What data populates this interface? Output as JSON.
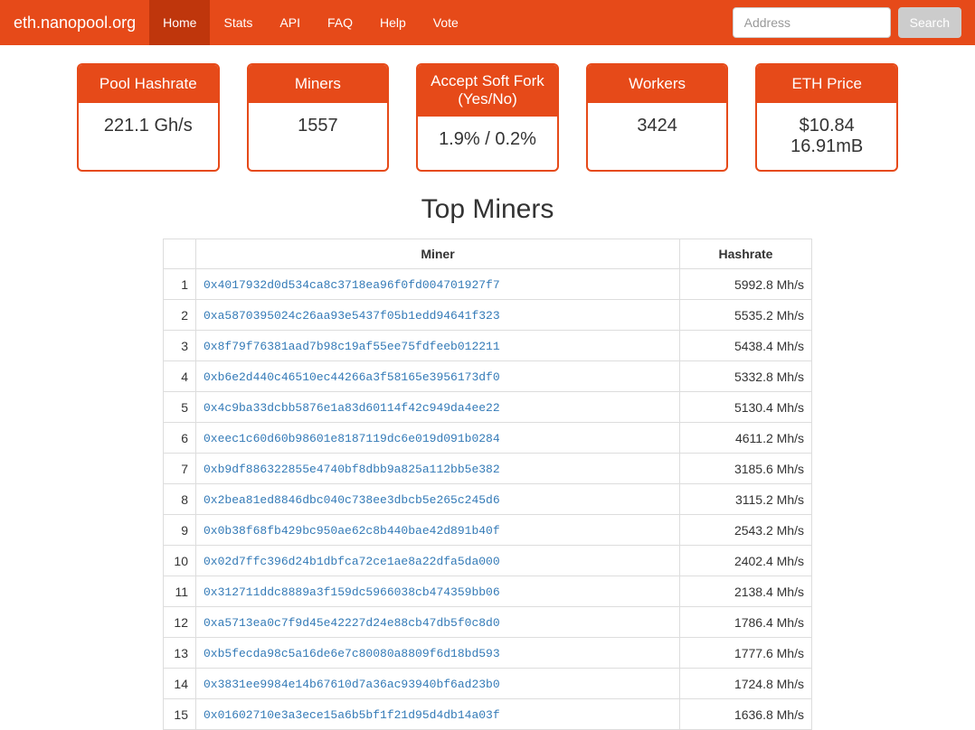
{
  "nav": {
    "brand": "eth.nanopool.org",
    "items": [
      "Home",
      "Stats",
      "API",
      "FAQ",
      "Help",
      "Vote"
    ],
    "active_index": 0,
    "search_placeholder": "Address",
    "search_btn": "Search"
  },
  "stats": [
    {
      "label": "Pool Hashrate",
      "value": "221.1 Gh/s"
    },
    {
      "label": "Miners",
      "value": "1557"
    },
    {
      "label": "Accept Soft Fork (Yes/No)",
      "value": "1.9% / 0.2%"
    },
    {
      "label": "Workers",
      "value": "3424"
    },
    {
      "label": "ETH Price",
      "value": "$10.84 16.91mB"
    }
  ],
  "section_title": "Top Miners",
  "table": {
    "columns": [
      "",
      "Miner",
      "Hashrate"
    ],
    "rows": [
      {
        "rank": 1,
        "miner": "0x4017932d0d534ca8c3718ea96f0fd004701927f7",
        "hashrate": "5992.8 Mh/s"
      },
      {
        "rank": 2,
        "miner": "0xa5870395024c26aa93e5437f05b1edd94641f323",
        "hashrate": "5535.2 Mh/s"
      },
      {
        "rank": 3,
        "miner": "0x8f79f76381aad7b98c19af55ee75fdfeeb012211",
        "hashrate": "5438.4 Mh/s"
      },
      {
        "rank": 4,
        "miner": "0xb6e2d440c46510ec44266a3f58165e3956173df0",
        "hashrate": "5332.8 Mh/s"
      },
      {
        "rank": 5,
        "miner": "0x4c9ba33dcbb5876e1a83d60114f42c949da4ee22",
        "hashrate": "5130.4 Mh/s"
      },
      {
        "rank": 6,
        "miner": "0xeec1c60d60b98601e8187119dc6e019d091b0284",
        "hashrate": "4611.2 Mh/s"
      },
      {
        "rank": 7,
        "miner": "0xb9df886322855e4740bf8dbb9a825a112bb5e382",
        "hashrate": "3185.6 Mh/s"
      },
      {
        "rank": 8,
        "miner": "0x2bea81ed8846dbc040c738ee3dbcb5e265c245d6",
        "hashrate": "3115.2 Mh/s"
      },
      {
        "rank": 9,
        "miner": "0x0b38f68fb429bc950ae62c8b440bae42d891b40f",
        "hashrate": "2543.2 Mh/s"
      },
      {
        "rank": 10,
        "miner": "0x02d7ffc396d24b1dbfca72ce1ae8a22dfa5da000",
        "hashrate": "2402.4 Mh/s"
      },
      {
        "rank": 11,
        "miner": "0x312711ddc8889a3f159dc5966038cb474359bb06",
        "hashrate": "2138.4 Mh/s"
      },
      {
        "rank": 12,
        "miner": "0xa5713ea0c7f9d45e42227d24e88cb47db5f0c8d0",
        "hashrate": "1786.4 Mh/s"
      },
      {
        "rank": 13,
        "miner": "0xb5fecda98c5a16de6e7c80080a8809f6d18bd593",
        "hashrate": "1777.6 Mh/s"
      },
      {
        "rank": 14,
        "miner": "0x3831ee9984e14b67610d7a36ac93940bf6ad23b0",
        "hashrate": "1724.8 Mh/s"
      },
      {
        "rank": 15,
        "miner": "0x01602710e3a3ece15a6b5bf1f21d95d4db14a03f",
        "hashrate": "1636.8 Mh/s"
      }
    ]
  }
}
